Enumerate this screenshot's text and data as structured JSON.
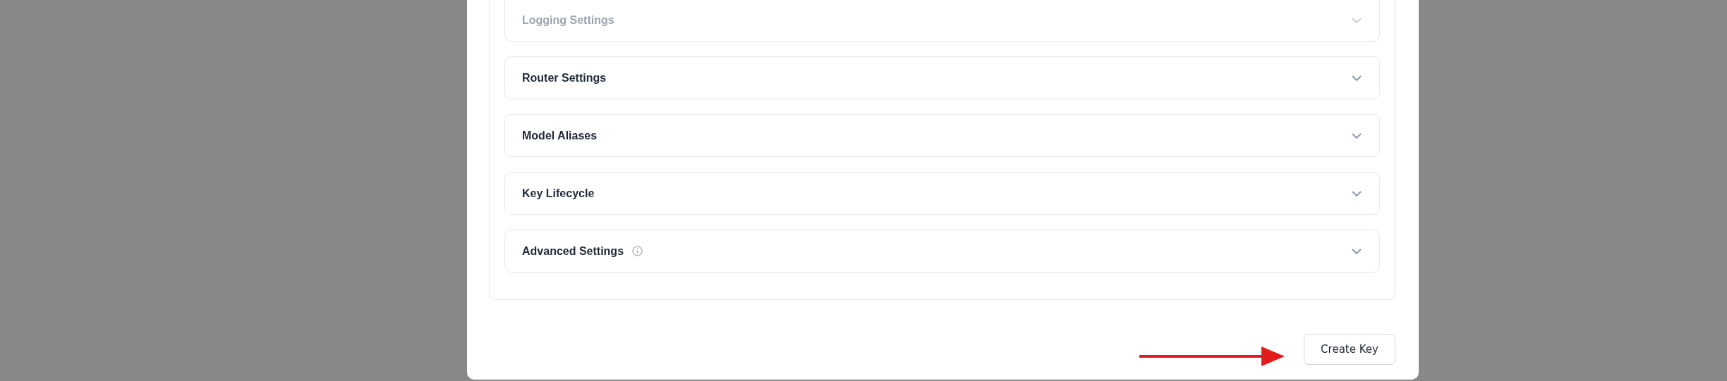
{
  "sections": [
    {
      "title": "Logging Settings",
      "disabled": true,
      "info": false
    },
    {
      "title": "Router Settings",
      "disabled": false,
      "info": false
    },
    {
      "title": "Model Aliases",
      "disabled": false,
      "info": false
    },
    {
      "title": "Key Lifecycle",
      "disabled": false,
      "info": false
    },
    {
      "title": "Advanced Settings",
      "disabled": false,
      "info": true
    }
  ],
  "submit_button": {
    "label": "Create Key"
  }
}
